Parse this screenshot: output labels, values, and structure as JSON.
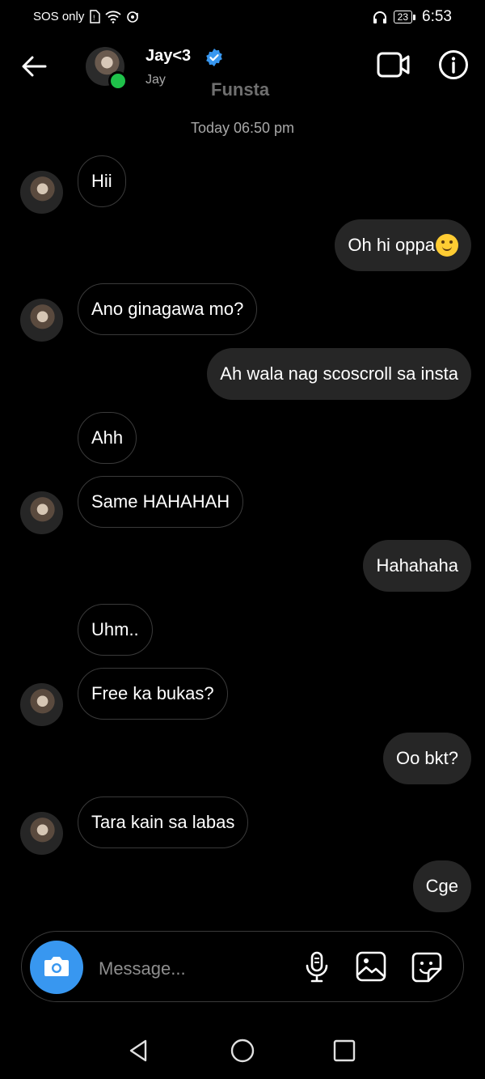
{
  "status_bar": {
    "carrier": "SOS only",
    "battery": "23",
    "time": "6:53"
  },
  "header": {
    "title": "Jay<3",
    "subtitle": "Jay",
    "account_type": "Funsta",
    "icons": [
      "back-arrow-icon",
      "verified-badge-icon",
      "video-call-icon",
      "info-icon"
    ]
  },
  "conversation": {
    "timestamp": "Today 06:50 pm",
    "messages": [
      {
        "from": "them",
        "text": "Hii"
      },
      {
        "from": "me",
        "text": "Oh hi oppa",
        "emoji": "smiling-face-emoji"
      },
      {
        "from": "them",
        "text": "Ano ginagawa mo?"
      },
      {
        "from": "me",
        "text": "Ah wala nag scoscroll sa insta"
      },
      {
        "from": "them",
        "text": "Ahh"
      },
      {
        "from": "them",
        "text": "Same HAHAHAH"
      },
      {
        "from": "me",
        "text": "Hahahaha"
      },
      {
        "from": "them",
        "text": "Uhm.."
      },
      {
        "from": "them",
        "text": "Free ka bukas?"
      },
      {
        "from": "me",
        "text": "Oo bkt?"
      },
      {
        "from": "them",
        "text": "Tara kain sa labas"
      },
      {
        "from": "me",
        "text": "Cge"
      }
    ]
  },
  "composer": {
    "placeholder": "Message...",
    "icons": [
      "camera-icon",
      "microphone-icon",
      "gallery-icon",
      "sticker-icon"
    ]
  },
  "colors": {
    "background": "#000000",
    "outgoing_bubble": "#262626",
    "incoming_border": "#3a3a3a",
    "accent_blue": "#3897f0",
    "online_green": "#1fc14a"
  }
}
